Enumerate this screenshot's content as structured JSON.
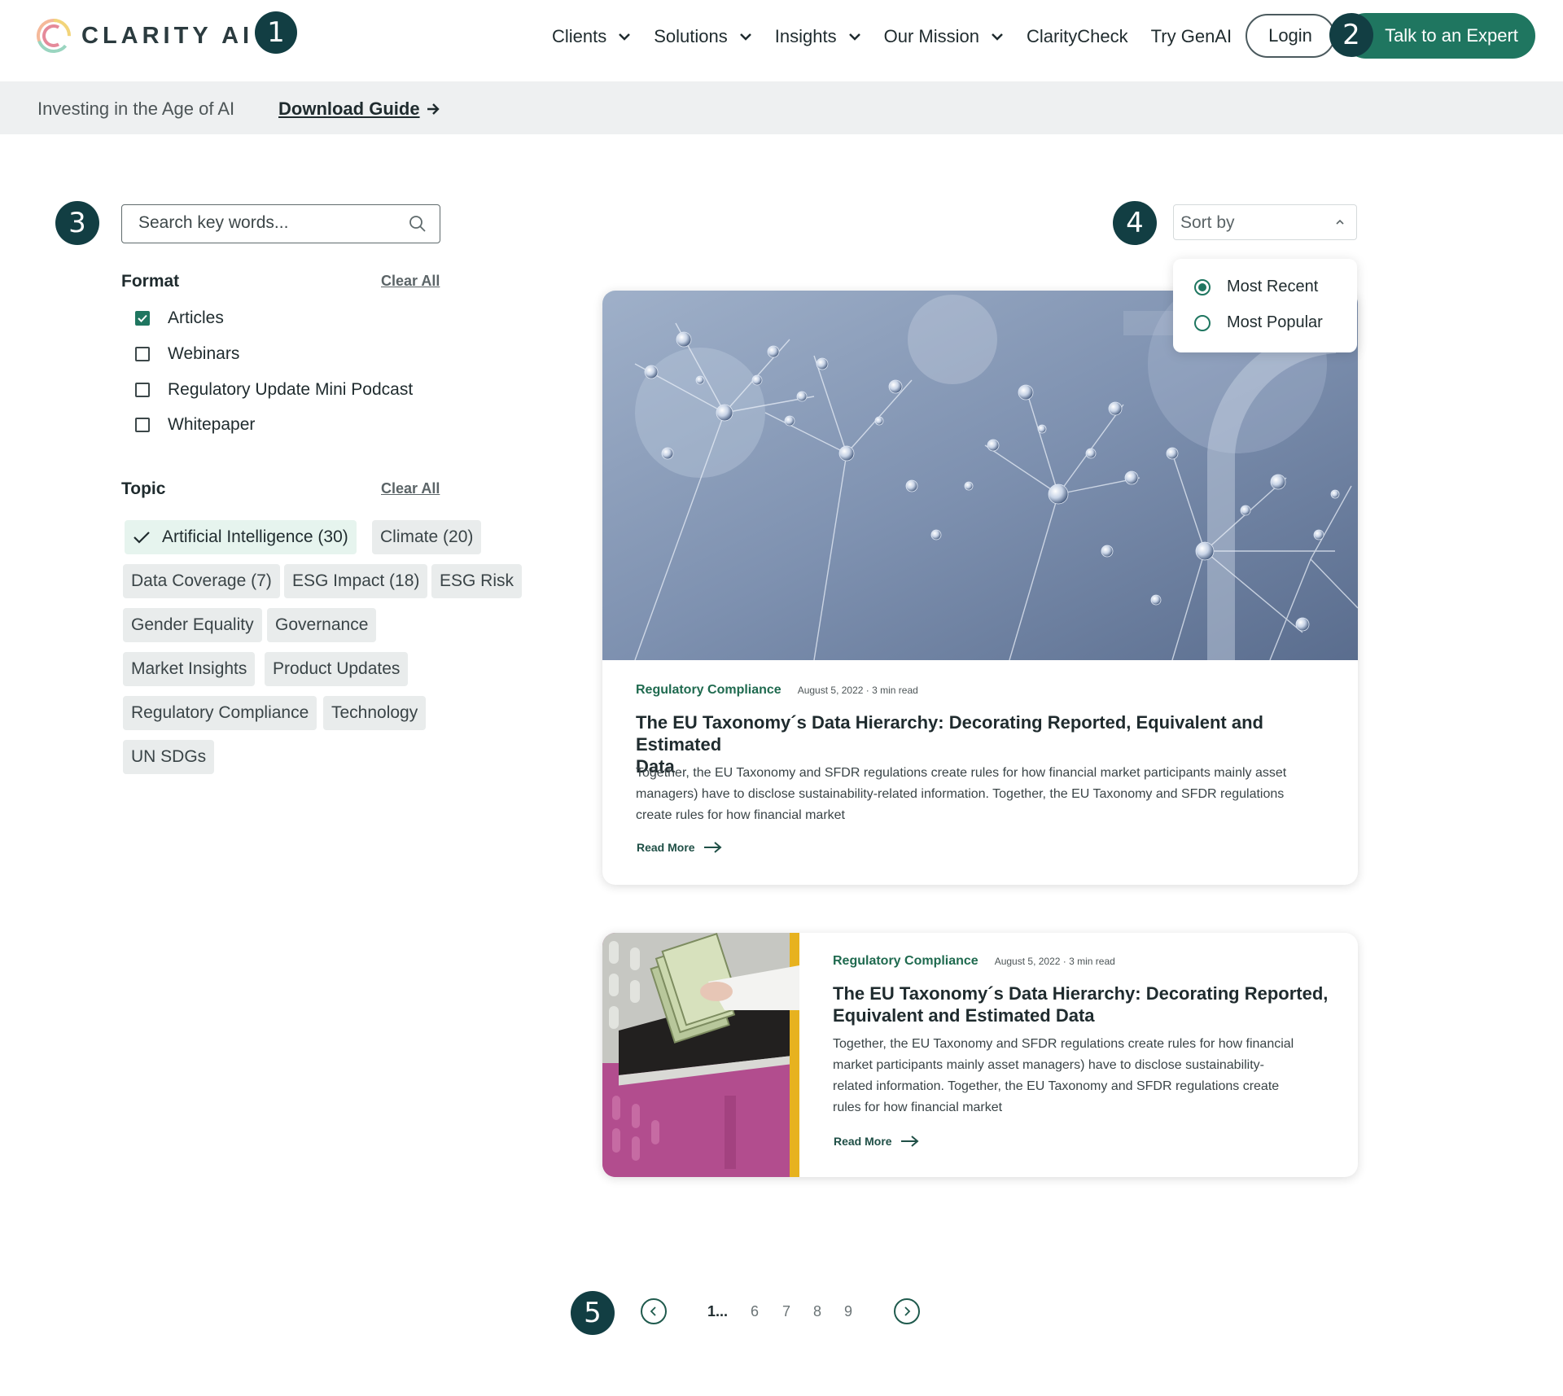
{
  "header": {
    "logo_text": "CLARITY AI",
    "nav": [
      {
        "label": "Clients",
        "has_dropdown": true
      },
      {
        "label": "Solutions",
        "has_dropdown": true
      },
      {
        "label": "Insights",
        "has_dropdown": true
      },
      {
        "label": "Our Mission",
        "has_dropdown": true
      },
      {
        "label": "ClarityCheck",
        "has_dropdown": false
      },
      {
        "label": "Try GenAI",
        "has_dropdown": false
      }
    ],
    "login_label": "Login",
    "cta_label": "Talk to an Expert"
  },
  "markers": [
    "1",
    "2",
    "3",
    "4",
    "5"
  ],
  "banner": {
    "text": "Investing in the Age of AI",
    "link_label": "Download Guide"
  },
  "search": {
    "placeholder": "Search key words...",
    "value": ""
  },
  "filters": {
    "format": {
      "title": "Format",
      "clear_label": "Clear All",
      "options": [
        {
          "label": "Articles",
          "checked": true
        },
        {
          "label": "Webinars",
          "checked": false
        },
        {
          "label": "Regulatory Update Mini Podcast",
          "checked": false
        },
        {
          "label": "Whitepaper",
          "checked": false
        }
      ]
    },
    "topic": {
      "title": "Topic",
      "clear_label": "Clear All",
      "chips": [
        {
          "label": "Artificial Intelligence (30)",
          "selected": true
        },
        {
          "label": "Climate (20)",
          "selected": false
        },
        {
          "label": "Data Coverage (7)",
          "selected": false
        },
        {
          "label": "ESG Impact (18)",
          "selected": false
        },
        {
          "label": "ESG Risk",
          "selected": false
        },
        {
          "label": "Gender Equality",
          "selected": false
        },
        {
          "label": "Governance",
          "selected": false
        },
        {
          "label": "Market Insights",
          "selected": false
        },
        {
          "label": "Product Updates",
          "selected": false
        },
        {
          "label": "Regulatory Compliance",
          "selected": false
        },
        {
          "label": "Technology",
          "selected": false
        },
        {
          "label": "UN SDGs",
          "selected": false
        }
      ]
    }
  },
  "sort": {
    "label": "Sort by",
    "options": [
      {
        "label": "Most Recent",
        "selected": true
      },
      {
        "label": "Most Popular",
        "selected": false
      }
    ]
  },
  "articles": [
    {
      "category": "Regulatory Compliance",
      "meta": "August 5, 2022 · 3 min read",
      "title_lines": [
        "The EU Taxonomy´s Data Hierarchy: Decorating Reported, Equivalent and Estimated",
        "Data"
      ],
      "desc_lines": [
        "Together, the EU Taxonomy and SFDR regulations create rules for how financial market participants mainly asset",
        "managers) have to disclose sustainability-related information. Together, the EU Taxonomy and SFDR regulations",
        "create rules for how financial market"
      ],
      "read_more": "Read More",
      "image": "dew-covered-dandelion-seeds"
    },
    {
      "category": "Regulatory Compliance",
      "meta": "August 5, 2022 · 3 min read",
      "title_lines": [
        "The EU Taxonomy´s Data Hierarchy: Decorating Reported,",
        "Equivalent and Estimated Data"
      ],
      "desc_lines": [
        "Together, the EU Taxonomy and SFDR regulations create rules for how financial",
        "market participants mainly asset managers) have to disclose sustainability-",
        "related information. Together, the EU Taxonomy and SFDR regulations create",
        "rules for how financial market"
      ],
      "read_more": "Read More",
      "image": "hand-with-banknotes-at-pink-window"
    }
  ],
  "pagination": {
    "pages": [
      "1...",
      "6",
      "7",
      "8",
      "9"
    ],
    "current": "1..."
  },
  "colors": {
    "brand_green": "#1f7660",
    "marker_navy": "#123e43",
    "banner_bg": "#eef0f1",
    "chip_bg": "#e9ecec",
    "chip_active_bg": "#e6f4ee"
  }
}
